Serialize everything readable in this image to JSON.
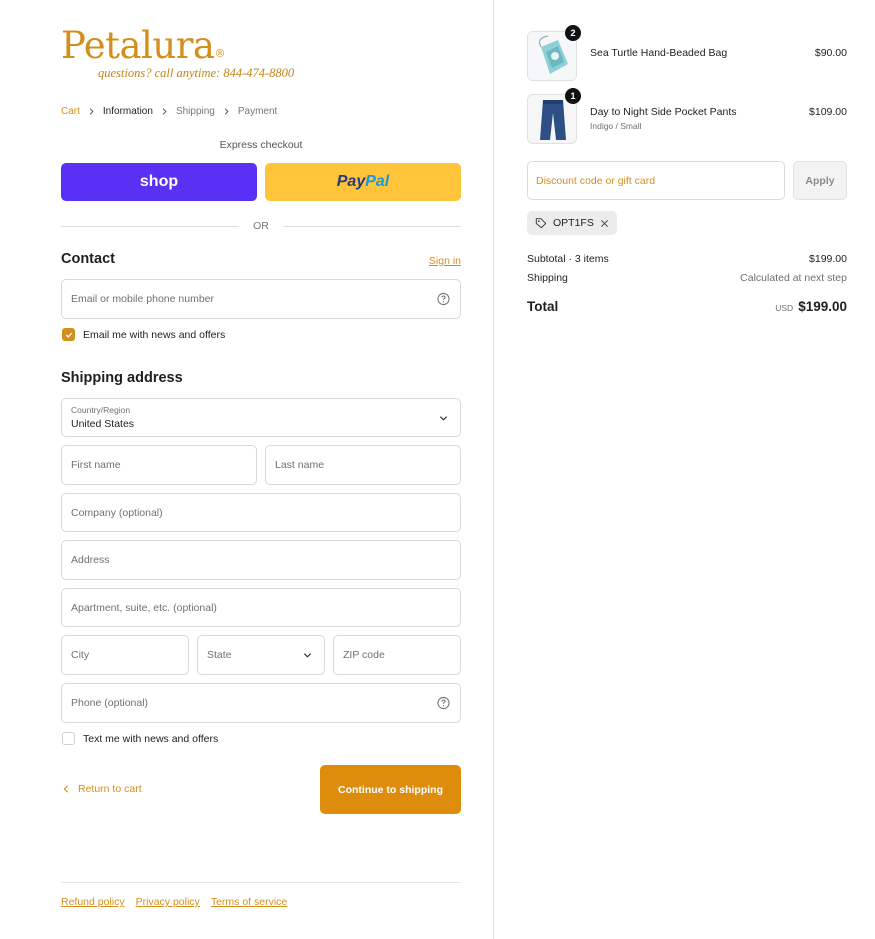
{
  "brand": {
    "name": "Petalura",
    "reg": "®",
    "tagline": "questions? call anytime: 844-474-8800"
  },
  "breadcrumb": [
    {
      "label": "Cart",
      "state": "link"
    },
    {
      "label": "Information",
      "state": "current"
    },
    {
      "label": "Shipping",
      "state": "upcoming"
    },
    {
      "label": "Payment",
      "state": "upcoming"
    }
  ],
  "express": {
    "label": "Express checkout",
    "shop_label": "shop",
    "paypal_a": "Pay",
    "paypal_b": "Pal",
    "or_label": "OR"
  },
  "contact": {
    "heading": "Contact",
    "signin": "Sign in",
    "email_placeholder": "Email or mobile phone number",
    "news_label": "Email me with news and offers",
    "news_checked": true
  },
  "shipping": {
    "heading": "Shipping address",
    "country_label": "Country/Region",
    "country_value": "United States",
    "first_name": "First name",
    "last_name": "Last name",
    "company": "Company (optional)",
    "address": "Address",
    "apartment": "Apartment, suite, etc. (optional)",
    "city": "City",
    "state": "State",
    "zip": "ZIP code",
    "phone": "Phone (optional)",
    "text_label": "Text me with news and offers",
    "text_checked": false
  },
  "actions": {
    "return": "Return to cart",
    "continue": "Continue to shipping"
  },
  "footer": {
    "refund": "Refund policy",
    "privacy": "Privacy policy",
    "terms": "Terms of service"
  },
  "order": {
    "items": [
      {
        "name": "Sea Turtle Hand-Beaded Bag",
        "variant": "",
        "price": "$90.00",
        "qty": "2"
      },
      {
        "name": "Day to Night Side Pocket Pants",
        "variant": "Indigo / Small",
        "price": "$109.00",
        "qty": "1"
      }
    ],
    "discount_placeholder": "Discount code or gift card",
    "apply": "Apply",
    "code": "OPT1FS",
    "subtotal_label": "Subtotal · 3 items",
    "subtotal_value": "$199.00",
    "shipping_label": "Shipping",
    "shipping_value": "Calculated at next step",
    "total_label": "Total",
    "currency": "USD",
    "total_value": "$199.00"
  },
  "colors": {
    "accent": "#d38f1d",
    "continue_button": "#dd8d0b",
    "shop_pay": "#5a31f4",
    "paypal": "#ffc439"
  }
}
